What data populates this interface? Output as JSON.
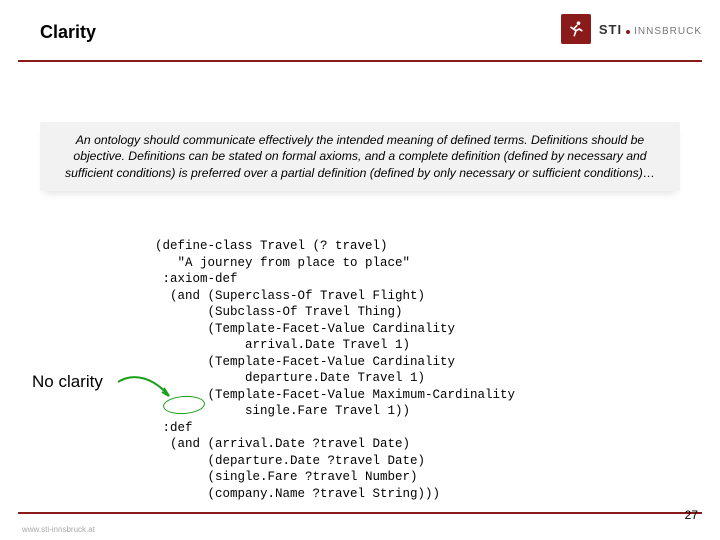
{
  "header": {
    "title": "Clarity",
    "logo": {
      "sti": "STI",
      "inns": "INNSBRUCK"
    }
  },
  "intro": "An ontology should communicate effectively the intended meaning of defined terms. Definitions should be objective. Definitions can be stated on formal axioms, and a complete definition (defined by necessary and sufficient conditions) is preferred over a partial definition (defined by only necessary or sufficient conditions)…",
  "label_noclarity": "No clarity",
  "code": "(define-class Travel (? travel)\n   \"A journey from place to place\"\n :axiom-def\n  (and (Superclass-Of Travel Flight)\n       (Subclass-Of Travel Thing)\n       (Template-Facet-Value Cardinality\n            arrival.Date Travel 1)\n       (Template-Facet-Value Cardinality\n            departure.Date Travel 1)\n       (Template-Facet-Value Maximum-Cardinality\n            single.Fare Travel 1))\n :def\n  (and (arrival.Date ?travel Date)\n       (departure.Date ?travel Date)\n       (single.Fare ?travel Number)\n       (company.Name ?travel String)))",
  "footer": {
    "page": "27",
    "site": "www.sti-innsbruck.at"
  }
}
